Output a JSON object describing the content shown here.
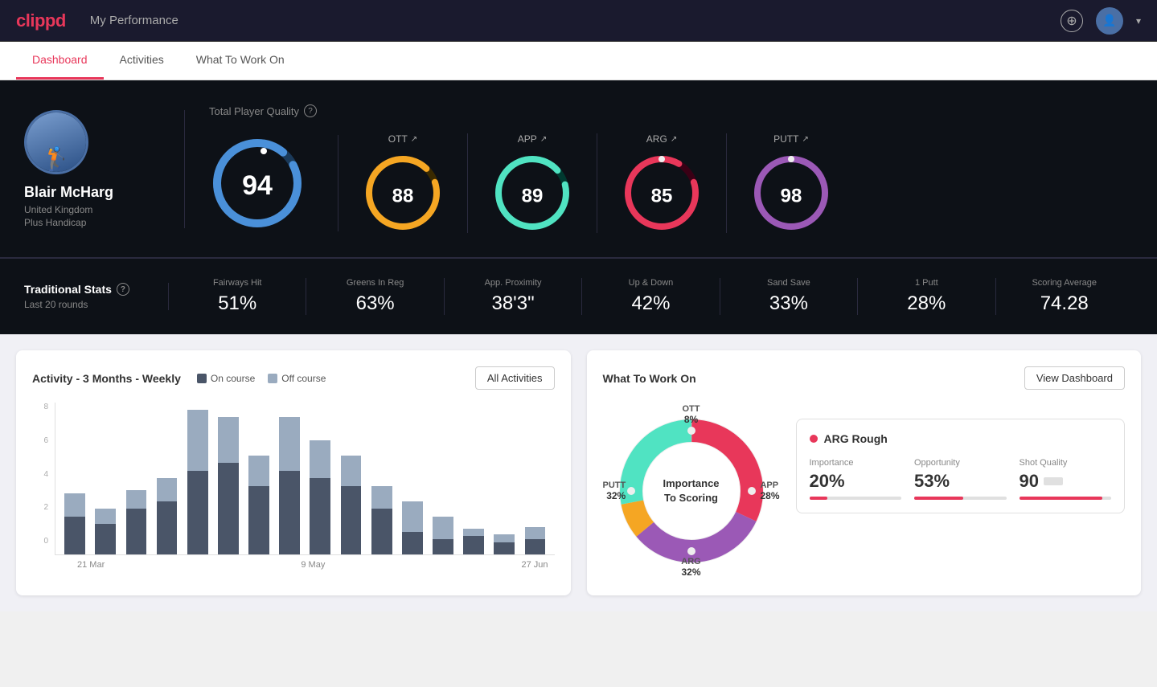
{
  "app": {
    "logo": "clippd",
    "header_title": "My Performance"
  },
  "nav": {
    "tabs": [
      {
        "label": "Dashboard",
        "active": true
      },
      {
        "label": "Activities",
        "active": false
      },
      {
        "label": "What To Work On",
        "active": false
      }
    ]
  },
  "player": {
    "name": "Blair McHarg",
    "country": "United Kingdom",
    "handicap": "Plus Handicap",
    "avatar_emoji": "🏌️"
  },
  "quality": {
    "section_label": "Total Player Quality",
    "total": {
      "value": "94",
      "color": "#4a90d9",
      "track": "#1a3a5a"
    },
    "metrics": [
      {
        "label": "OTT",
        "value": "88",
        "color": "#f5a623",
        "track": "#3a2a00"
      },
      {
        "label": "APP",
        "value": "89",
        "color": "#50e3c2",
        "track": "#003a30"
      },
      {
        "label": "ARG",
        "value": "85",
        "color": "#e8375a",
        "track": "#3a0015"
      },
      {
        "label": "PUTT",
        "value": "98",
        "color": "#9b59b6",
        "track": "#2a0040"
      }
    ]
  },
  "traditional_stats": {
    "title": "Traditional Stats",
    "subtitle": "Last 20 rounds",
    "items": [
      {
        "name": "Fairways Hit",
        "value": "51%"
      },
      {
        "name": "Greens In Reg",
        "value": "63%"
      },
      {
        "name": "App. Proximity",
        "value": "38'3\""
      },
      {
        "name": "Up & Down",
        "value": "42%"
      },
      {
        "name": "Sand Save",
        "value": "33%"
      },
      {
        "name": "1 Putt",
        "value": "28%"
      },
      {
        "name": "Scoring Average",
        "value": "74.28"
      }
    ]
  },
  "activity_chart": {
    "title": "Activity - 3 Months - Weekly",
    "legend_on_course": "On course",
    "legend_off_course": "Off course",
    "all_activities_btn": "All Activities",
    "y_labels": [
      "0",
      "2",
      "4",
      "6",
      "8"
    ],
    "x_labels": [
      "21 Mar",
      "9 May",
      "27 Jun"
    ],
    "bars": [
      {
        "on": 25,
        "off": 15
      },
      {
        "on": 20,
        "off": 10
      },
      {
        "on": 30,
        "off": 12
      },
      {
        "on": 35,
        "off": 15
      },
      {
        "on": 55,
        "off": 40
      },
      {
        "on": 60,
        "off": 30
      },
      {
        "on": 45,
        "off": 20
      },
      {
        "on": 55,
        "off": 35
      },
      {
        "on": 50,
        "off": 25
      },
      {
        "on": 45,
        "off": 20
      },
      {
        "on": 30,
        "off": 15
      },
      {
        "on": 15,
        "off": 20
      },
      {
        "on": 10,
        "off": 15
      },
      {
        "on": 12,
        "off": 5
      },
      {
        "on": 8,
        "off": 5
      },
      {
        "on": 10,
        "off": 8
      }
    ]
  },
  "work_on": {
    "title": "What To Work On",
    "view_dashboard_btn": "View Dashboard",
    "donut_center": "Importance\nTo Scoring",
    "segments": [
      {
        "label": "OTT",
        "value": "8%",
        "color": "#f5a623"
      },
      {
        "label": "APP",
        "value": "28%",
        "color": "#50e3c2"
      },
      {
        "label": "ARG",
        "value": "32%",
        "color": "#e8375a"
      },
      {
        "label": "PUTT",
        "value": "32%",
        "color": "#9b59b6"
      }
    ],
    "detail": {
      "title": "ARG Rough",
      "dot_color": "#e8375a",
      "metrics": [
        {
          "label": "Importance",
          "value": "20%",
          "fill": 20
        },
        {
          "label": "Opportunity",
          "value": "53%",
          "fill": 53
        },
        {
          "label": "Shot Quality",
          "value": "90",
          "fill": 90
        }
      ]
    }
  }
}
